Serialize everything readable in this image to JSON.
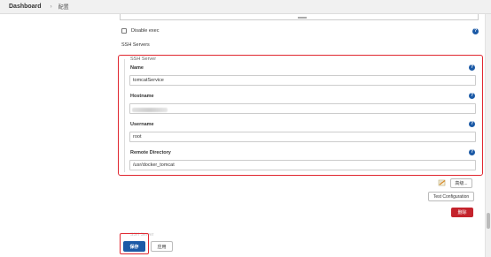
{
  "breadcrumb": {
    "dashboard": "Dashboard",
    "separator": "›",
    "current": "配置"
  },
  "disable_exec": {
    "label": "Disable exec",
    "checked": false
  },
  "section_title": "SSH Servers",
  "ssh_server": {
    "heading": "SSH Server",
    "fields": [
      {
        "label": "Name",
        "value": "tomcatService"
      },
      {
        "label": "Hostname",
        "value": ""
      },
      {
        "label": "Username",
        "value": "root"
      },
      {
        "label": "Remote Directory",
        "value": "/usr/docker_tomcat"
      }
    ]
  },
  "buttons": {
    "advanced": "高级...",
    "test_configuration": "Test Configuration",
    "delete": "删除",
    "save": "保存",
    "apply": "应用"
  },
  "ghost_label": "SSH Server",
  "help_glyph": "?",
  "colors": {
    "accent_blue": "#1c5aa6",
    "highlight_red": "#e0262f",
    "delete_red": "#c4232c"
  }
}
